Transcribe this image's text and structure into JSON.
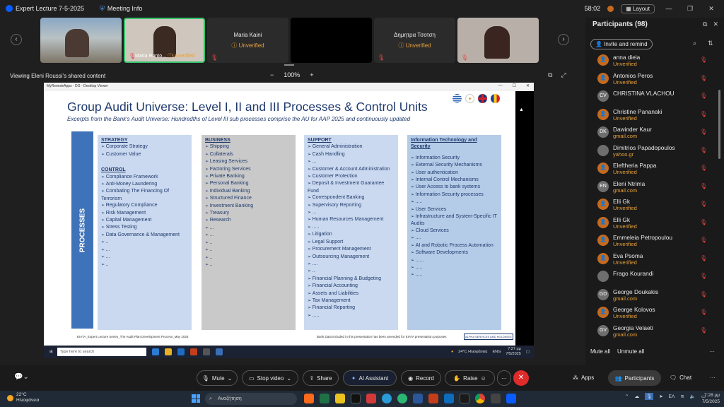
{
  "titlebar": {
    "app_name": "Expert Lecture 7-5-2025",
    "info_label": "Meeting Info",
    "time": "58:02",
    "layout_label": "Layout"
  },
  "tiles": [
    {
      "name": "",
      "status": ""
    },
    {
      "name": "Maria Ronto...",
      "status": "Unverified"
    },
    {
      "name": "Maria Kaini",
      "status": "Unverified"
    },
    {
      "name": "",
      "status": ""
    },
    {
      "name": "Δημητρα Τσοτση",
      "status": "Unverified"
    },
    {
      "name": "",
      "status": ""
    }
  ],
  "share": {
    "viewing_label": "Viewing Eleni Roussi's shared content",
    "zoom": "100%",
    "minus": "−",
    "plus": "+"
  },
  "remote": {
    "title": "MyRemoteApps - DG - Desktop Viewer"
  },
  "slide": {
    "title": "Group Audit Universe: Level I, II and III Processes & Control Units",
    "subtitle": "Excerpts from the Bank's Audit Universe: Hundredths of Level III sub processes comprise the AU for AAP 2025 and continuously updated",
    "processes_label": "PROCESSES",
    "strategy_head": "STRATEGY",
    "strategy": [
      "Corporate Strategy",
      "Customer Value"
    ],
    "control_head": "CONTROL",
    "control": [
      "Compliance Framework",
      "Anti-Money Laundering",
      "Combating The Financing Of Terrorism",
      "Regulatory Compliance",
      "Risk Management",
      "Capital Management",
      "Stress Testing",
      "Data Governance & Management",
      "..",
      "...",
      "...",
      ".."
    ],
    "business_head": "BUSINESS",
    "business": [
      "Shipping",
      "Collaterals",
      "Leasing Services",
      "Factoring Services",
      "Private Banking",
      "Personal Banking",
      "Individual Banking",
      "Structured Finance",
      "Investment Banking",
      "Treasury",
      "Research",
      "...",
      "...",
      "..",
      "..",
      "..",
      ".."
    ],
    "support_head": "SUPPORT",
    "support": [
      "General Administration",
      "Cash Handling",
      "...",
      "Customer & Account Administration",
      "Customer Protection",
      "Deposit & Investment Guarantee Fund",
      "Correspondent Banking",
      "Supervisory Reporting",
      "...",
      "Human Resources Management",
      ".....",
      "Litigation",
      "Legal Support",
      "Procurement Management",
      "Outsourcing Management",
      "....",
      "..",
      "Financial Planning & Budgeting",
      "Financial Accounting",
      "Assets and Liabilities",
      "Tax Management",
      "Financial Reporting",
      "....."
    ],
    "it_head": "Information Technology and Security",
    "it": [
      "Information Security",
      "External Security Mechanisms",
      "User authentication",
      "Internal Control Mechanisms",
      "User Access to bank systems",
      "Information Security processes",
      ".....",
      "User Services",
      "Infrastructure and System-Specific IT Audits",
      "Cloud Services",
      "....",
      "AI and Robotic Process Automation",
      "Software Developments",
      "......",
      ".....",
      "....."
    ],
    "footer_left": "EIATA_Expert Lecture Series_The Audit Plan Development Process_May 2025",
    "footer_right": "Bank Data included in this presentation has been amended for EIATA presentation purposes",
    "logo_text": "ALPHA SERVICES AND HOLDINGS"
  },
  "inner_taskbar": {
    "search": "Type here to search",
    "weather": "24°C Ηλιοφάνεια",
    "lang": "ENG",
    "time": "7:27 μμ",
    "date": "7/5/2025"
  },
  "participants": {
    "title": "Participants (98)",
    "invite": "Invite and remind",
    "list": [
      {
        "initials": "",
        "name": "anna dieia",
        "sub": "Unverified",
        "guest": true
      },
      {
        "initials": "",
        "name": "Antonios Peros",
        "sub": "Unverified",
        "guest": true
      },
      {
        "initials": "CV",
        "name": "CHRISTINA VLACHOU",
        "sub": "",
        "guest": false
      },
      {
        "initials": "",
        "name": "Christine Pananaki",
        "sub": "Unverified",
        "guest": true
      },
      {
        "initials": "DK",
        "name": "Dawinder Kaur",
        "sub": "gmail.com",
        "guest": false
      },
      {
        "initials": "",
        "name": "Dimitrios Papadopoulos",
        "sub": "yahoo.gr",
        "guest": false
      },
      {
        "initials": "",
        "name": "Eleftheria Pappa",
        "sub": "Unverified",
        "guest": true
      },
      {
        "initials": "EN",
        "name": "Eleni Ntrima",
        "sub": "gmail.com",
        "guest": false
      },
      {
        "initials": "",
        "name": "Elli Gk",
        "sub": "Unverified",
        "guest": true
      },
      {
        "initials": "",
        "name": "Elli Gk",
        "sub": "Unverified",
        "guest": true
      },
      {
        "initials": "",
        "name": "Emmeleia Petropoulou",
        "sub": "Unverified",
        "guest": true
      },
      {
        "initials": "",
        "name": "Eva  Psoma",
        "sub": "Unverified",
        "guest": true
      },
      {
        "initials": "",
        "name": "Frago Kourandi",
        "sub": "",
        "guest": false
      },
      {
        "initials": "GD",
        "name": "George Doukakis",
        "sub": "gmail.com",
        "guest": false
      },
      {
        "initials": "",
        "name": "George Kolovos",
        "sub": "Unverified",
        "guest": true
      },
      {
        "initials": "GV",
        "name": "Georgia Velaeti",
        "sub": "gmail.com",
        "guest": false
      }
    ],
    "mute_all": "Mute all",
    "unmute_all": "Unmute all"
  },
  "toolbar": {
    "mute": "Mute",
    "stop_video": "Stop video",
    "share": "Share",
    "ai": "AI Assistant",
    "record": "Record",
    "raise": "Raise",
    "more": "···",
    "apps": "Apps",
    "participants": "Participants",
    "chat": "Chat"
  },
  "win": {
    "temp": "22°C",
    "cond": "Ηλιοφάνεια",
    "search": "Αναζήτηση",
    "lang": "ΕΛ",
    "time": "7:28 μμ",
    "date": "7/5/2025"
  }
}
